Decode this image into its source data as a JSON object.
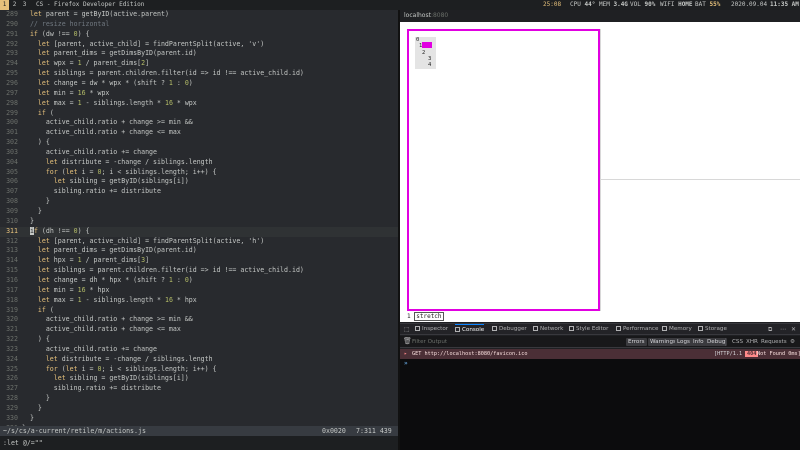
{
  "topbar": {
    "workspaces": [
      {
        "label": "1",
        "active": true
      },
      {
        "label": "2",
        "active": false
      },
      {
        "label": "3",
        "active": false
      }
    ],
    "window_title": "CS - Firefox Developer Edition",
    "status": {
      "time_small": "25:08",
      "cpu_label": "CPU",
      "cpu_value": "44°",
      "mem_label": "MEM",
      "mem_value": "3.4G",
      "vol_label": "VOL",
      "vol_value": "90%",
      "wifi_label": "WIFI",
      "wifi_value": "HOME",
      "bat_label": "BAT",
      "bat_value": "55%",
      "date": "2020.09.04",
      "clock": "11:35 AM"
    }
  },
  "editor": {
    "lines": [
      {
        "n": "289",
        "t": "  let parent = getByID(active.parent)"
      },
      {
        "n": "290",
        "t": "  // resize horizontal"
      },
      {
        "n": "291",
        "t": "  if (dw !== 0) {"
      },
      {
        "n": "292",
        "t": "    let [parent, active_child] = findParentSplit(active, 'v')"
      },
      {
        "n": "293",
        "t": "    let parent_dims = getDimsByID(parent.id)"
      },
      {
        "n": "294",
        "t": "    let wpx = 1 / parent_dims[2]"
      },
      {
        "n": "295",
        "t": "    let siblings = parent.children.filter(id => id !== active_child.id)"
      },
      {
        "n": "296",
        "t": "    let change = dw * wpx * (shift ? 1 : 0)"
      },
      {
        "n": "297",
        "t": "    let min = 16 * wpx"
      },
      {
        "n": "298",
        "t": "    let max = 1 - siblings.length * 16 * wpx"
      },
      {
        "n": "299",
        "t": "    if ("
      },
      {
        "n": "300",
        "t": "      active_child.ratio + change >= min &&"
      },
      {
        "n": "301",
        "t": "      active_child.ratio + change <= max"
      },
      {
        "n": "302",
        "t": "    ) {"
      },
      {
        "n": "303",
        "t": "      active_child.ratio += change"
      },
      {
        "n": "304",
        "t": "      let distribute = -change / siblings.length"
      },
      {
        "n": "305",
        "t": "      for (let i = 0; i < siblings.length; i++) {"
      },
      {
        "n": "306",
        "t": "        let sibling = getByID(siblings[i])"
      },
      {
        "n": "307",
        "t": "        sibling.ratio += distribute"
      },
      {
        "n": "308",
        "t": "      }"
      },
      {
        "n": "309",
        "t": "    }"
      },
      {
        "n": "310",
        "t": "  }"
      },
      {
        "n": "311",
        "t": "  if (dh !== 0) {"
      },
      {
        "n": "312",
        "t": "    let [parent, active_child] = findParentSplit(active, 'h')"
      },
      {
        "n": "313",
        "t": "    let parent_dims = getDimsByID(parent.id)"
      },
      {
        "n": "314",
        "t": "    let hpx = 1 / parent_dims[3]"
      },
      {
        "n": "315",
        "t": "    let siblings = parent.children.filter(id => id !== active_child.id)"
      },
      {
        "n": "316",
        "t": "    let change = dh * hpx * (shift ? 1 : 0)"
      },
      {
        "n": "317",
        "t": "    let min = 16 * hpx"
      },
      {
        "n": "318",
        "t": "    let max = 1 - siblings.length * 16 * hpx"
      },
      {
        "n": "319",
        "t": "    if ("
      },
      {
        "n": "320",
        "t": "      active_child.ratio + change >= min &&"
      },
      {
        "n": "321",
        "t": "      active_child.ratio + change <= max"
      },
      {
        "n": "322",
        "t": "    ) {"
      },
      {
        "n": "323",
        "t": "      active_child.ratio += change"
      },
      {
        "n": "324",
        "t": "      let distribute = -change / siblings.length"
      },
      {
        "n": "325",
        "t": "      for (let i = 0; i < siblings.length; i++) {"
      },
      {
        "n": "326",
        "t": "        let sibling = getByID(siblings[i])"
      },
      {
        "n": "327",
        "t": "        sibling.ratio += distribute"
      },
      {
        "n": "328",
        "t": "      }"
      },
      {
        "n": "329",
        "t": "    }"
      },
      {
        "n": "330",
        "t": "  }"
      },
      {
        "n": "331",
        "t": "}"
      },
      {
        "n": "332",
        "t": "}"
      },
      {
        "n": "333",
        "t": ""
      }
    ],
    "current_line": "311",
    "filepath": "~/s/cs/a-current/retile/m/actions.js",
    "hex": "0x0020",
    "position": "7:311 439",
    "cmdline": ":let @/=\"\""
  },
  "browser": {
    "url_host": "localhost",
    "url_port": ":8080",
    "mini_labels": [
      "0",
      "1",
      "2",
      "3",
      "4"
    ],
    "bottom_index": "1",
    "bottom_label": "stretch"
  },
  "devtools": {
    "tabs": [
      {
        "label": "Inspector",
        "icon": "inspector-icon",
        "active": false
      },
      {
        "label": "Console",
        "icon": "console-icon",
        "active": true
      },
      {
        "label": "Debugger",
        "icon": "debugger-icon",
        "active": false
      },
      {
        "label": "Network",
        "icon": "network-icon",
        "active": false
      },
      {
        "label": "Style Editor",
        "icon": "style-editor-icon",
        "active": false
      },
      {
        "label": "Performance",
        "icon": "performance-icon",
        "active": false
      },
      {
        "label": "Memory",
        "icon": "memory-icon",
        "active": false
      },
      {
        "label": "Storage",
        "icon": "storage-icon",
        "active": false
      }
    ],
    "filter_placeholder": "Filter Output",
    "filters": [
      "Errors",
      "Warnings",
      "Logs",
      "Info",
      "Debug"
    ],
    "filters2": [
      "CSS",
      "XHR",
      "Requests"
    ],
    "error": {
      "message": "GET http://localhost:8080/favicon.ico",
      "http": "[HTTP/1.1",
      "code": "404",
      "status_text": "Not Found 0ms]"
    },
    "prompt": "»"
  },
  "colors": {
    "accent_magenta": "#e100e1",
    "editor_bg": "#282a2e",
    "keyword": "#e5c07b",
    "number": "#b5bd68",
    "comment": "#707880",
    "devtools_active_tab": "#0a84ff",
    "error_row": "#4b2f36"
  }
}
